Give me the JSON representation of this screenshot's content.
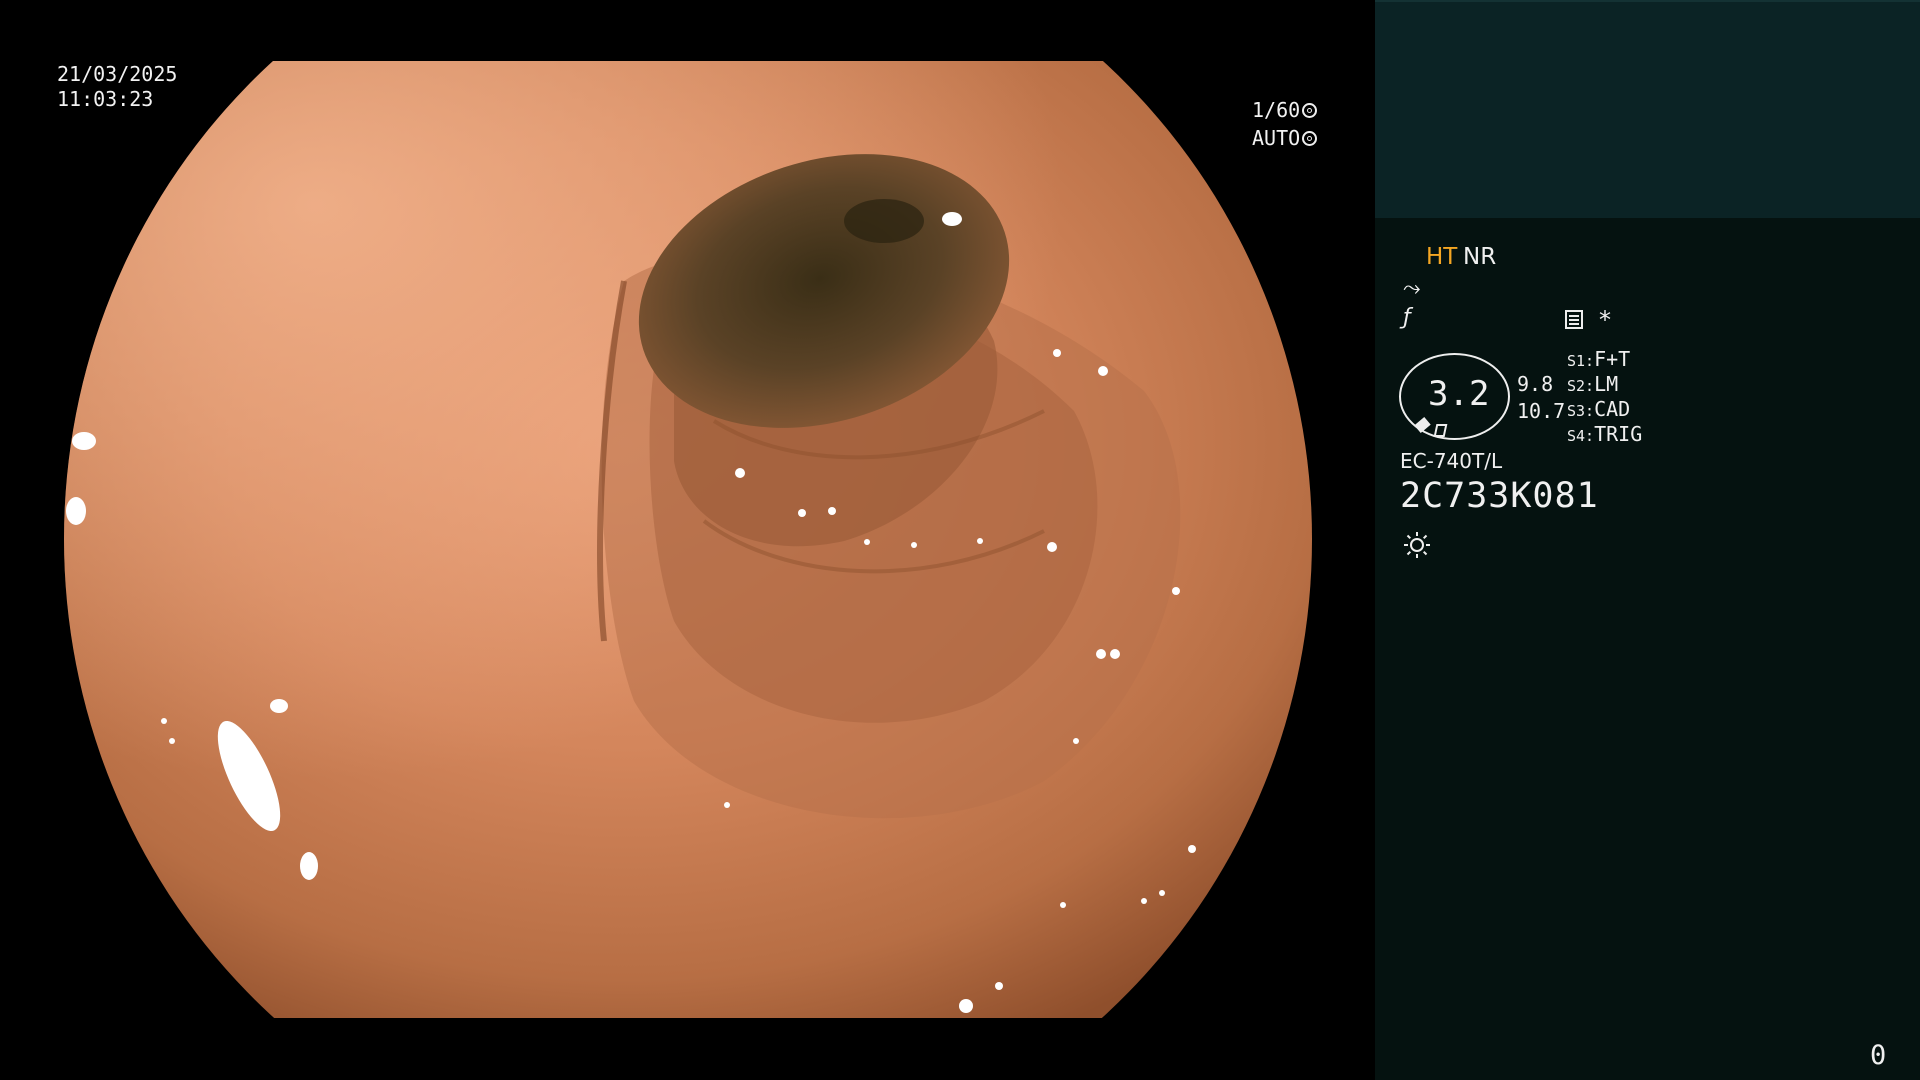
{
  "overlay": {
    "date": "21/03/2025",
    "time": "11:03:23",
    "shutter": "1/60",
    "exposure_mode": "AUTO"
  },
  "panel": {
    "mode_ht": "HT",
    "mode_nr": "NR",
    "wave_icon_glyph": "⤳",
    "f_icon_glyph": "ƒ",
    "asterisk": "*",
    "zoom_value": "3.2",
    "value_a": "9.8",
    "value_b": "10.7",
    "switches": [
      {
        "key": "S1:",
        "value": "F+T"
      },
      {
        "key": "S2:",
        "value": "LM"
      },
      {
        "key": "S3:",
        "value": "CAD"
      },
      {
        "key": "S4:",
        "value": "TRIG"
      }
    ],
    "scope_model": "EC-740T/L",
    "serial": "2C733K081",
    "counter": "0",
    "colors": {
      "ht": "#f5a623",
      "panel_bg": "#051210",
      "panel_top_bg": "#0b2325"
    },
    "icons": [
      "shutter-icon",
      "auto-exposure-icon",
      "wave-icon",
      "f-icon",
      "document-icon",
      "pen-icon",
      "brightness-sun-icon"
    ]
  }
}
